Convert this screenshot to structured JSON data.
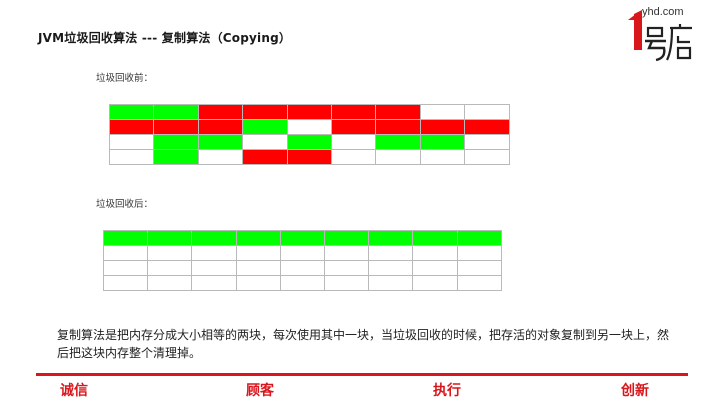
{
  "slide": {
    "title": "JVM垃圾回收算法 --- 复制算法（Copying）"
  },
  "logo": {
    "url_text": "yhd.com"
  },
  "before": {
    "label": "垃圾回收前：",
    "rows": [
      [
        "g",
        "g",
        "r",
        "r",
        "r",
        "r",
        "r",
        "w",
        "w"
      ],
      [
        "r",
        "r",
        "r",
        "g",
        "w",
        "r",
        "r",
        "r",
        "r"
      ],
      [
        "w",
        "g",
        "g",
        "w",
        "g",
        "w",
        "g",
        "g",
        "w"
      ],
      [
        "w",
        "g",
        "w",
        "r",
        "r",
        "w",
        "w",
        "w",
        "w"
      ]
    ]
  },
  "after": {
    "label": "垃圾回收后：",
    "rows": [
      [
        "g",
        "g",
        "g",
        "g",
        "g",
        "g",
        "g",
        "g",
        "g"
      ],
      [
        "w",
        "w",
        "w",
        "w",
        "w",
        "w",
        "w",
        "w",
        "w"
      ],
      [
        "w",
        "w",
        "w",
        "w",
        "w",
        "w",
        "w",
        "w",
        "w"
      ],
      [
        "w",
        "w",
        "w",
        "w",
        "w",
        "w",
        "w",
        "w",
        "w"
      ]
    ]
  },
  "colors": {
    "g": "#00ff00",
    "r": "#ff0000",
    "w": "#ffffff",
    "accent": "#d9161c"
  },
  "description": "复制算法是把内存分成大小相等的两块，每次使用其中一块，当垃圾回收的时候，把存活的对象复制到另一块上，然后把这块内存整个清理掉。",
  "footer": {
    "words": [
      "诚信",
      "顾客",
      "执行",
      "创新"
    ]
  }
}
